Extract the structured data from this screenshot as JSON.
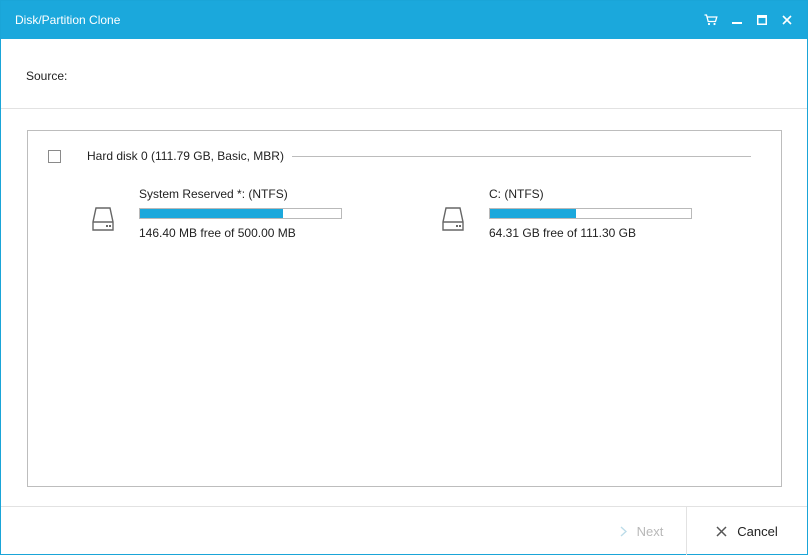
{
  "window": {
    "title": "Disk/Partition Clone",
    "controls": [
      "cart-icon",
      "minimize-icon",
      "maximize-icon",
      "close-icon"
    ]
  },
  "source": {
    "label": "Source:"
  },
  "disk": {
    "title": "Hard disk 0 (111.79 GB, Basic, MBR)",
    "checked": false,
    "expanded": true,
    "partitions": [
      {
        "name": "System Reserved *: (NTFS)",
        "free_text": "146.40 MB free of 500.00 MB",
        "used_fraction": 0.71,
        "icon": "hard-drive-icon"
      },
      {
        "name": "C: (NTFS)",
        "free_text": "64.31 GB free of 111.30 GB",
        "used_fraction": 0.43,
        "icon": "hard-drive-icon"
      }
    ]
  },
  "footer": {
    "next_label": "Next",
    "cancel_label": "Cancel",
    "next_enabled": false
  },
  "colors": {
    "accent": "#1ba8dc",
    "disabled_text": "#b8b8b8"
  }
}
